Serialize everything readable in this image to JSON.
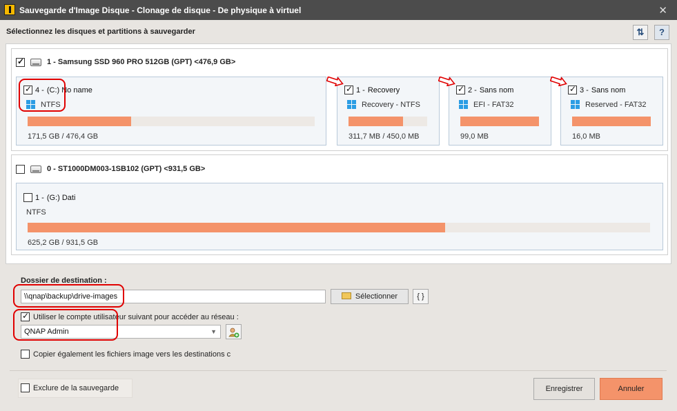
{
  "window": {
    "title": "Sauvegarde d'Image Disque - Clonage de disque - De physique à virtuel",
    "close_glyph": "✕"
  },
  "header": {
    "label": "Sélectionnez les disques et partitions à sauvegarder",
    "refresh_glyph": "⇅",
    "help_glyph": "?"
  },
  "disks": [
    {
      "label": "1 - Samsung SSD 960 PRO 512GB (GPT) <476,9 GB>",
      "checked": true,
      "partitions": [
        {
          "number": "4 -",
          "name": "(C:) No name",
          "fs": "NTFS",
          "size": "171,5 GB / 476,4 GB",
          "used_fraction": 0.36,
          "checked": true,
          "windows_icon": true
        },
        {
          "number": "1 -",
          "name": "Recovery",
          "fs": "Recovery - NTFS",
          "size": "311,7 MB / 450,0 MB",
          "used_fraction": 0.69,
          "checked": true,
          "windows_icon": true
        },
        {
          "number": "2 -",
          "name": "Sans nom",
          "fs": "EFI - FAT32",
          "size": "99,0 MB",
          "used_fraction": 1.0,
          "checked": true,
          "windows_icon": true
        },
        {
          "number": "3 -",
          "name": "Sans nom",
          "fs": "Reserved - FAT32",
          "size": "16,0 MB",
          "used_fraction": 1.0,
          "checked": true,
          "windows_icon": true
        }
      ]
    },
    {
      "label": "0 - ST1000DM003-1SB102 (GPT) <931,5 GB>",
      "checked": false,
      "partitions": [
        {
          "number": "1 -",
          "name": "(G:) Dati",
          "fs": "NTFS",
          "size": "625,2 GB / 931,5 GB",
          "used_fraction": 0.671,
          "checked": false,
          "windows_icon": false
        }
      ]
    }
  ],
  "destination": {
    "label": "Dossier de destination :",
    "path": "\\\\qnap\\backup\\drive-images",
    "select_label": "Sélectionner",
    "braces_label": "{ }"
  },
  "network": {
    "use_account_label": "Utiliser le compte utilisateur suivant pour accéder au réseau :",
    "use_account_checked": true,
    "account_value": "QNAP Admin"
  },
  "copy_label": "Copier également les fichiers image vers les destinations c",
  "footer": {
    "exclude_label": "Exclure de la sauvegarde",
    "save_label": "Enregistrer",
    "cancel_label": "Annuler"
  },
  "colors": {
    "accent": "#f4936a",
    "annotation": "#e00000",
    "windows_blue": "#2b9de4"
  }
}
